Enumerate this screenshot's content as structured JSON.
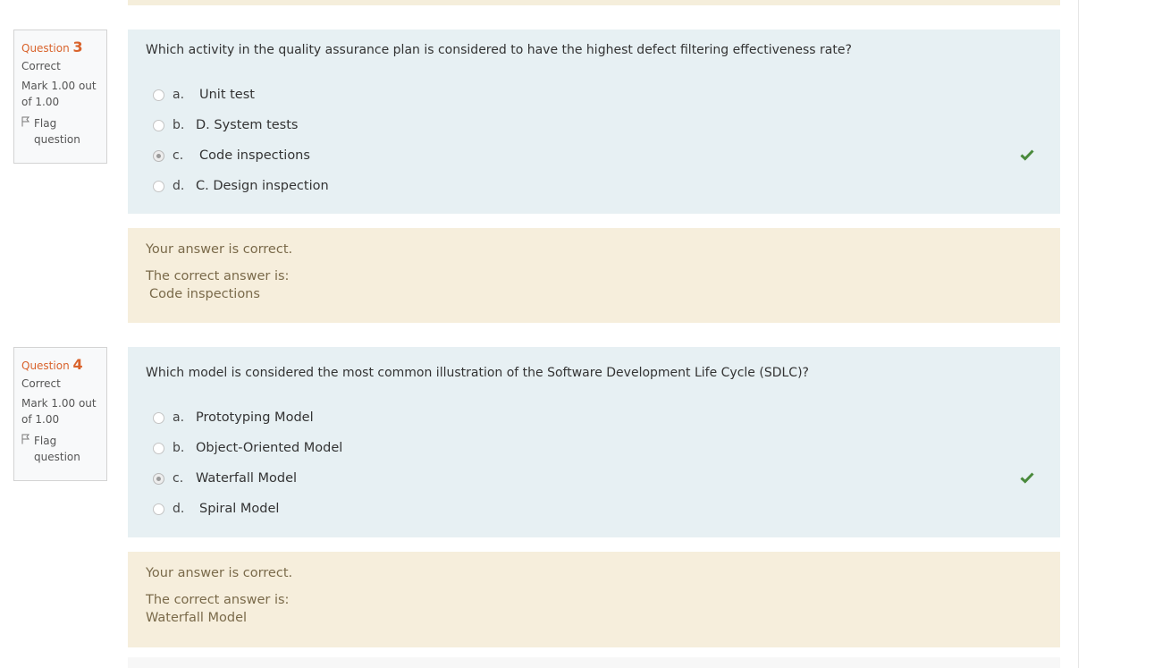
{
  "questions": [
    {
      "label": "Question",
      "number": "3",
      "state": "Correct",
      "grade": "Mark 1.00 out of 1.00",
      "flag_label": "Flag question",
      "text": "Which activity in the quality assurance plan is considered to have the highest defect filtering effectiveness rate?",
      "options": [
        {
          "letter": "a.",
          "text": "Unit test",
          "selected": false
        },
        {
          "letter": "b.",
          "text": "D. System tests",
          "selected": false
        },
        {
          "letter": "c.",
          "text": "Code inspections",
          "selected": true
        },
        {
          "letter": "d.",
          "text": "C. Design inspection",
          "selected": false
        }
      ],
      "feedback_status": "Your answer is correct.",
      "feedback_intro": "The correct answer is:",
      "feedback_answer": "Code inspections"
    },
    {
      "label": "Question",
      "number": "4",
      "state": "Correct",
      "grade": "Mark 1.00 out of 1.00",
      "flag_label": "Flag question",
      "text": "Which model is considered the most common illustration of the Software Development Life Cycle (SDLC)?",
      "options": [
        {
          "letter": "a.",
          "text": "Prototyping Model",
          "selected": false
        },
        {
          "letter": "b.",
          "text": "Object-Oriented Model",
          "selected": false
        },
        {
          "letter": "c.",
          "text": "Waterfall Model",
          "selected": true
        },
        {
          "letter": "d.",
          "text": "Spiral Model",
          "selected": false
        }
      ],
      "feedback_status": "Your answer is correct.",
      "feedback_intro": "The correct answer is:",
      "feedback_answer": "Waterfall Model"
    }
  ],
  "colors": {
    "accent": "#d9632c",
    "question_bg": "#e7f0f3",
    "feedback_bg": "#f6eedc",
    "correct": "#4a8a3c"
  },
  "icons": {
    "flag": "flag-icon",
    "correct": "checkmark-icon",
    "radio": "radio-button"
  }
}
